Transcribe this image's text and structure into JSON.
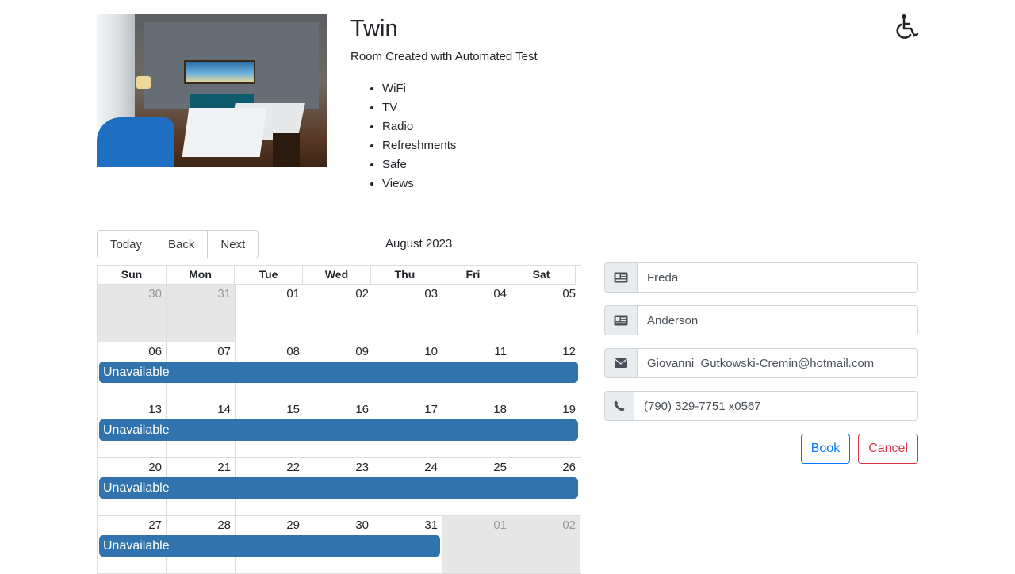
{
  "room": {
    "title": "Twin",
    "description": "Room Created with Automated Test",
    "features": [
      "WiFi",
      "TV",
      "Radio",
      "Refreshments",
      "Safe",
      "Views"
    ],
    "image_icon": "room-photo",
    "accessibility_icon": "wheelchair-icon"
  },
  "calendar": {
    "today_label": "Today",
    "back_label": "Back",
    "next_label": "Next",
    "month_label": "August 2023",
    "weekdays": [
      "Sun",
      "Mon",
      "Tue",
      "Wed",
      "Thu",
      "Fri",
      "Sat"
    ],
    "weeks": [
      {
        "days": [
          {
            "n": "30",
            "off": true
          },
          {
            "n": "31",
            "off": true
          },
          {
            "n": "01"
          },
          {
            "n": "02"
          },
          {
            "n": "03"
          },
          {
            "n": "04"
          },
          {
            "n": "05"
          }
        ],
        "event": null
      },
      {
        "days": [
          {
            "n": "06"
          },
          {
            "n": "07"
          },
          {
            "n": "08"
          },
          {
            "n": "09"
          },
          {
            "n": "10"
          },
          {
            "n": "11"
          },
          {
            "n": "12"
          }
        ],
        "event": {
          "label": "Unavailable",
          "span_days": 7
        }
      },
      {
        "days": [
          {
            "n": "13"
          },
          {
            "n": "14"
          },
          {
            "n": "15"
          },
          {
            "n": "16"
          },
          {
            "n": "17"
          },
          {
            "n": "18"
          },
          {
            "n": "19"
          }
        ],
        "event": {
          "label": "Unavailable",
          "span_days": 7
        }
      },
      {
        "days": [
          {
            "n": "20"
          },
          {
            "n": "21"
          },
          {
            "n": "22"
          },
          {
            "n": "23"
          },
          {
            "n": "24"
          },
          {
            "n": "25"
          },
          {
            "n": "26"
          }
        ],
        "event": {
          "label": "Unavailable",
          "span_days": 7
        }
      },
      {
        "days": [
          {
            "n": "27"
          },
          {
            "n": "28"
          },
          {
            "n": "29"
          },
          {
            "n": "30"
          },
          {
            "n": "31"
          },
          {
            "n": "01",
            "off": true
          },
          {
            "n": "02",
            "off": true
          }
        ],
        "event": {
          "label": "Unavailable",
          "span_days": 5
        }
      }
    ],
    "event_color": "#3174ad"
  },
  "form": {
    "firstname": {
      "value": "Freda",
      "icon": "id-card-icon"
    },
    "lastname": {
      "value": "Anderson",
      "icon": "id-card-icon"
    },
    "email": {
      "value": "Giovanni_Gutkowski-Cremin@hotmail.com",
      "icon": "envelope-icon"
    },
    "phone": {
      "value": "(790) 329-7751 x0567",
      "icon": "phone-icon"
    },
    "book_label": "Book",
    "cancel_label": "Cancel"
  }
}
